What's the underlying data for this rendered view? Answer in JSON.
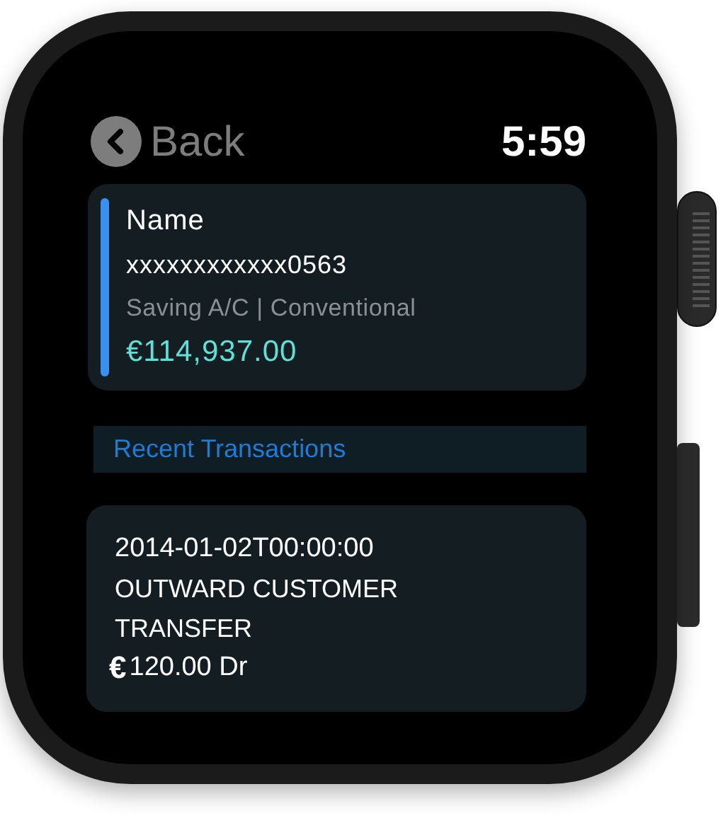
{
  "header": {
    "back_label": "Back",
    "time": "5:59"
  },
  "account": {
    "name": "Name",
    "number": "xxxxxxxxxxxx0563",
    "type": "Saving A/C | Conventional",
    "balance": "€114,937.00"
  },
  "section_title": "Recent Transactions",
  "transactions": [
    {
      "date": "2014-01-02T00:00:00",
      "description": "OUTWARD CUSTOMER TRANSFER",
      "currency": "€",
      "amount": "120.00 Dr"
    }
  ]
}
